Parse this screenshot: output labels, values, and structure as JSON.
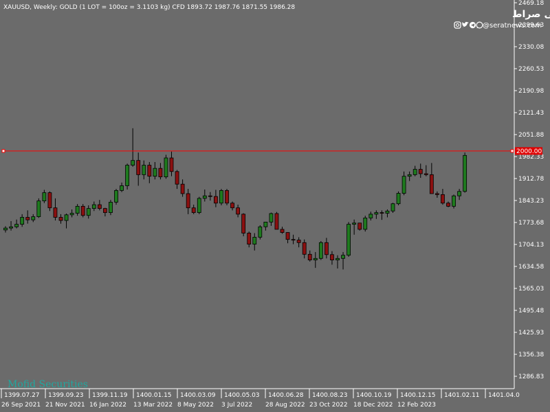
{
  "header": {
    "symbol_line": "XAUUSD, Weekly:  GOLD (1 LOT = 100oz = 3.1103 kg) CFD  1893.72 1987.76 1871.55 1986.28"
  },
  "brand": {
    "title": "پایگاه خبری تحلیلی صراط",
    "handle": "@seratnews.com",
    "social_icons": [
      "instagram-icon",
      "twitter-icon",
      "telegram-icon",
      "whatsapp-icon"
    ]
  },
  "watermark": "Mofid Securities",
  "colors": {
    "background": "#6b6b6b",
    "bull": "#1e7a1e",
    "bear": "#8b1010",
    "wick": "#000000",
    "level_line": "#ff0000"
  },
  "chart_data": {
    "type": "candlestick",
    "timeframe": "Weekly",
    "y_ticks": [
      2469.18,
      2399.63,
      2330.08,
      2260.53,
      2190.98,
      2121.43,
      2051.88,
      1982.33,
      1912.78,
      1843.23,
      1773.68,
      1704.13,
      1634.58,
      1565.03,
      1495.48,
      1425.93,
      1356.38,
      1286.83
    ],
    "ylim": [
      1256,
      2472
    ],
    "level_line": {
      "value": 2000.0,
      "label": "2000.00"
    },
    "x_labels_top": [
      "1399.07.27",
      "1399.09.23",
      "1399.11.19",
      "1400.01.15",
      "1400.03.09",
      "1400.05.03",
      "1400.06.28",
      "1400.08.23",
      "1400.10.19",
      "1400.12.15",
      "1401.02.11",
      "1401.04.0"
    ],
    "x_labels_bottom": [
      "26 Sep 2021",
      "21 Nov 2021",
      "16 Jan 2022",
      "13 Mar 2022",
      "8 May 2022",
      "3 Jul 2022",
      "28 Aug 2022",
      "23 Oct 2022",
      "18 Dec 2022",
      "12 Feb 2023"
    ],
    "candles": [
      [
        1750,
        1762,
        1742,
        1756
      ],
      [
        1756,
        1778,
        1748,
        1760
      ],
      [
        1760,
        1783,
        1755,
        1768
      ],
      [
        1768,
        1800,
        1760,
        1790
      ],
      [
        1790,
        1812,
        1770,
        1782
      ],
      [
        1782,
        1800,
        1775,
        1792
      ],
      [
        1792,
        1850,
        1788,
        1842
      ],
      [
        1842,
        1877,
        1835,
        1868
      ],
      [
        1868,
        1872,
        1810,
        1820
      ],
      [
        1820,
        1850,
        1780,
        1790
      ],
      [
        1790,
        1800,
        1770,
        1780
      ],
      [
        1780,
        1802,
        1755,
        1798
      ],
      [
        1798,
        1815,
        1790,
        1803
      ],
      [
        1803,
        1832,
        1795,
        1825
      ],
      [
        1825,
        1832,
        1790,
        1796
      ],
      [
        1796,
        1828,
        1786,
        1818
      ],
      [
        1818,
        1840,
        1810,
        1830
      ],
      [
        1830,
        1845,
        1812,
        1818
      ],
      [
        1818,
        1820,
        1793,
        1805
      ],
      [
        1805,
        1845,
        1797,
        1838
      ],
      [
        1838,
        1880,
        1830,
        1875
      ],
      [
        1875,
        1900,
        1870,
        1890
      ],
      [
        1890,
        1960,
        1878,
        1955
      ],
      [
        1955,
        2072,
        1950,
        1970
      ],
      [
        1970,
        1995,
        1890,
        1925
      ],
      [
        1925,
        1970,
        1910,
        1955
      ],
      [
        1955,
        1965,
        1898,
        1920
      ],
      [
        1920,
        1965,
        1910,
        1945
      ],
      [
        1945,
        1962,
        1910,
        1918
      ],
      [
        1918,
        1988,
        1912,
        1978
      ],
      [
        1978,
        1998,
        1920,
        1935
      ],
      [
        1935,
        1940,
        1880,
        1895
      ],
      [
        1895,
        1910,
        1855,
        1865
      ],
      [
        1865,
        1880,
        1800,
        1820
      ],
      [
        1820,
        1830,
        1800,
        1805
      ],
      [
        1805,
        1855,
        1800,
        1850
      ],
      [
        1850,
        1878,
        1840,
        1858
      ],
      [
        1858,
        1870,
        1843,
        1856
      ],
      [
        1856,
        1877,
        1822,
        1835
      ],
      [
        1835,
        1880,
        1828,
        1875
      ],
      [
        1875,
        1880,
        1828,
        1835
      ],
      [
        1835,
        1840,
        1812,
        1820
      ],
      [
        1820,
        1830,
        1790,
        1800
      ],
      [
        1800,
        1803,
        1730,
        1740
      ],
      [
        1740,
        1745,
        1695,
        1705
      ],
      [
        1705,
        1740,
        1685,
        1727
      ],
      [
        1727,
        1765,
        1720,
        1760
      ],
      [
        1760,
        1775,
        1748,
        1775
      ],
      [
        1775,
        1805,
        1763,
        1802
      ],
      [
        1802,
        1807,
        1760,
        1752
      ],
      [
        1752,
        1760,
        1738,
        1742
      ],
      [
        1742,
        1743,
        1708,
        1720
      ],
      [
        1720,
        1735,
        1705,
        1718
      ],
      [
        1718,
        1727,
        1695,
        1710
      ],
      [
        1710,
        1720,
        1660,
        1673
      ],
      [
        1673,
        1685,
        1650,
        1655
      ],
      [
        1655,
        1680,
        1630,
        1660
      ],
      [
        1660,
        1715,
        1655,
        1710
      ],
      [
        1710,
        1725,
        1660,
        1672
      ],
      [
        1672,
        1683,
        1640,
        1655
      ],
      [
        1655,
        1670,
        1628,
        1660
      ],
      [
        1660,
        1680,
        1625,
        1670
      ],
      [
        1670,
        1775,
        1665,
        1768
      ],
      [
        1768,
        1783,
        1735,
        1772
      ],
      [
        1772,
        1772,
        1748,
        1752
      ],
      [
        1752,
        1795,
        1745,
        1788
      ],
      [
        1788,
        1808,
        1780,
        1800
      ],
      [
        1800,
        1812,
        1785,
        1805
      ],
      [
        1805,
        1812,
        1782,
        1803
      ],
      [
        1803,
        1815,
        1790,
        1810
      ],
      [
        1810,
        1836,
        1804,
        1833
      ],
      [
        1833,
        1872,
        1828,
        1866
      ],
      [
        1866,
        1935,
        1860,
        1920
      ],
      [
        1920,
        1935,
        1905,
        1925
      ],
      [
        1925,
        1953,
        1920,
        1942
      ],
      [
        1942,
        1960,
        1915,
        1928
      ],
      [
        1928,
        1955,
        1920,
        1925
      ],
      [
        1925,
        1962,
        1912,
        1865
      ],
      [
        1865,
        1872,
        1852,
        1862
      ],
      [
        1862,
        1880,
        1830,
        1835
      ],
      [
        1835,
        1840,
        1822,
        1825
      ],
      [
        1825,
        1862,
        1818,
        1858
      ],
      [
        1858,
        1880,
        1845,
        1872
      ],
      [
        1872,
        1995,
        1868,
        1986
      ]
    ]
  }
}
